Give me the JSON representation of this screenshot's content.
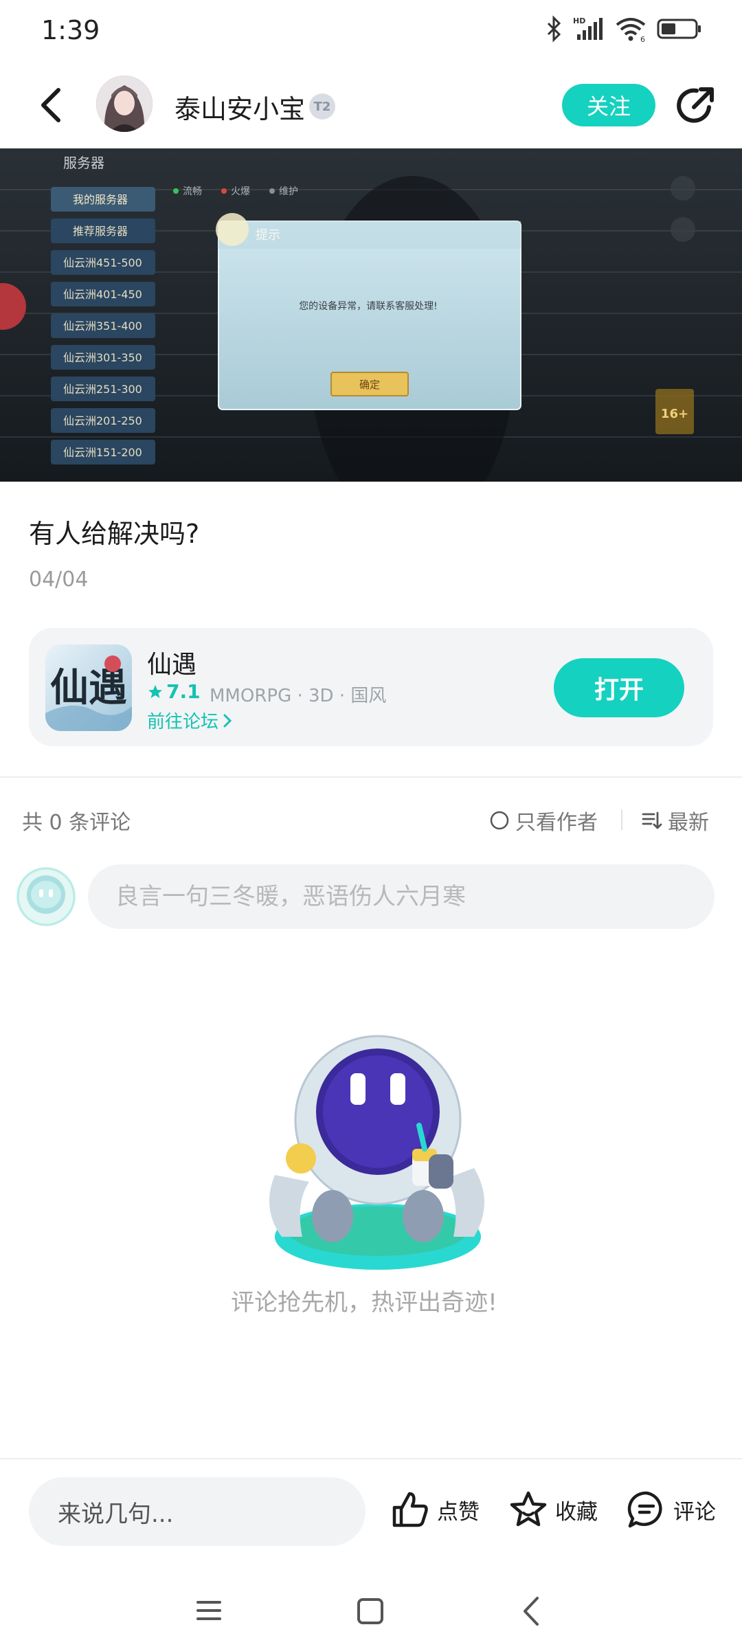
{
  "status_bar": {
    "time": "1:39",
    "network": "HD",
    "signal_label": "6"
  },
  "header": {
    "author_name": "泰山安小宝",
    "level_badge": "T2",
    "follow_label": "关注"
  },
  "post_image": {
    "panel_title": "服务器",
    "server_tabs": [
      "我的服务器",
      "推荐服务器",
      "仙云洲451-500",
      "仙云洲401-450",
      "仙云洲351-400",
      "仙云洲301-350",
      "仙云洲251-300",
      "仙云洲201-250",
      "仙云洲151-200"
    ],
    "legend": [
      "流畅",
      "火爆",
      "维护"
    ],
    "dialog_title": "提示",
    "dialog_message": "您的设备异常，请联系客服处理!",
    "dialog_confirm": "确定",
    "age_rating": "16+"
  },
  "post": {
    "title": "有人给解决吗?",
    "date": "04/04"
  },
  "game_card": {
    "name": "仙遇",
    "icon_text": "仙遇",
    "rating": "7.1",
    "tags": "MMORPG · 3D · 国风",
    "forum_link": "前往论坛",
    "open_label": "打开"
  },
  "comments": {
    "count_label": "共 0 条评论",
    "author_only_label": "只看作者",
    "sort_label": "最新",
    "input_placeholder": "良言一句三冬暖，恶语伤人六月寒",
    "empty_text": "评论抢先机，热评出奇迹!"
  },
  "bottom_bar": {
    "input_placeholder": "来说几句...",
    "like_label": "点赞",
    "favorite_label": "收藏",
    "comment_label": "评论"
  },
  "colors": {
    "accent": "#15d1bf",
    "accent_text": "#15c2b2"
  }
}
